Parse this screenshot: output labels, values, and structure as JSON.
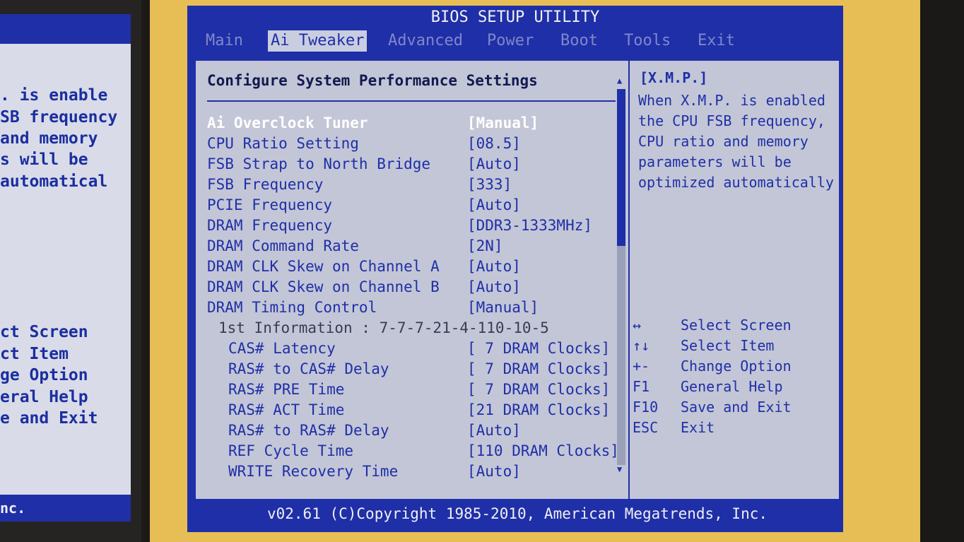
{
  "left_monitor": {
    "help_lines": [
      ". is enable",
      "SB frequency",
      " and memory",
      "s will be",
      " automatical"
    ],
    "key_lines": [
      "ct Screen",
      "ct Item",
      "ge Option",
      "eral Help",
      "e and Exit"
    ],
    "footer": "nc."
  },
  "bios": {
    "title": "BIOS SETUP UTILITY",
    "menu": [
      {
        "label": "Main",
        "active": false
      },
      {
        "label": "Ai Tweaker",
        "active": true
      },
      {
        "label": "Advanced",
        "active": false
      },
      {
        "label": "Power",
        "active": false
      },
      {
        "label": "Boot",
        "active": false
      },
      {
        "label": "Tools",
        "active": false
      },
      {
        "label": "Exit",
        "active": false
      }
    ],
    "section_title": "Configure System Performance Settings",
    "settings": [
      {
        "label": "Ai Overclock Tuner",
        "value": "[Manual]"
      },
      {
        "label": "CPU Ratio Setting",
        "value": "[08.5]"
      },
      {
        "label": "FSB Strap to North Bridge",
        "value": "[Auto]"
      },
      {
        "label": "FSB Frequency",
        "value": "[333]"
      },
      {
        "label": "PCIE Frequency",
        "value": "[Auto]"
      },
      {
        "label": "DRAM Frequency",
        "value": "[DDR3-1333MHz]"
      },
      {
        "label": "DRAM Command Rate",
        "value": "[2N]"
      },
      {
        "label": "DRAM CLK Skew on Channel A",
        "value": "[Auto]"
      },
      {
        "label": "DRAM CLK Skew on Channel B",
        "value": "[Auto]"
      },
      {
        "label": "DRAM Timing Control",
        "value": "[Manual]"
      },
      {
        "label": "1st Information : 7-7-7-21-4-110-10-5",
        "value": ""
      },
      {
        "label": "CAS# Latency",
        "value": "[ 7 DRAM Clocks]"
      },
      {
        "label": "RAS# to CAS# Delay",
        "value": "[ 7 DRAM Clocks]"
      },
      {
        "label": "RAS# PRE Time",
        "value": "[ 7 DRAM Clocks]"
      },
      {
        "label": "RAS# ACT Time",
        "value": "[21 DRAM Clocks]"
      },
      {
        "label": "RAS# to RAS# Delay",
        "value": "[Auto]"
      },
      {
        "label": "REF Cycle Time",
        "value": "[110 DRAM Clocks]"
      },
      {
        "label": "WRITE Recovery Time",
        "value": "[Auto]"
      }
    ],
    "help_title": "[X.M.P.]",
    "help_text": [
      "When X.M.P. is enabled",
      "the CPU FSB frequency,",
      "CPU ratio and memory",
      "parameters will be",
      "optimized automatically"
    ],
    "keys": [
      {
        "key": "↔",
        "desc": "Select Screen"
      },
      {
        "key": "↑↓",
        "desc": "Select Item"
      },
      {
        "key": "+-",
        "desc": "Change Option"
      },
      {
        "key": "F1",
        "desc": "General Help"
      },
      {
        "key": "F10",
        "desc": "Save and Exit"
      },
      {
        "key": "ESC",
        "desc": "Exit"
      }
    ],
    "footer": "v02.61 (C)Copyright 1985-2010, American Megatrends, Inc.",
    "colors": {
      "blue": "#1f2fa8",
      "panel": "#c3c6d6",
      "bezel": "#e6be55"
    }
  }
}
